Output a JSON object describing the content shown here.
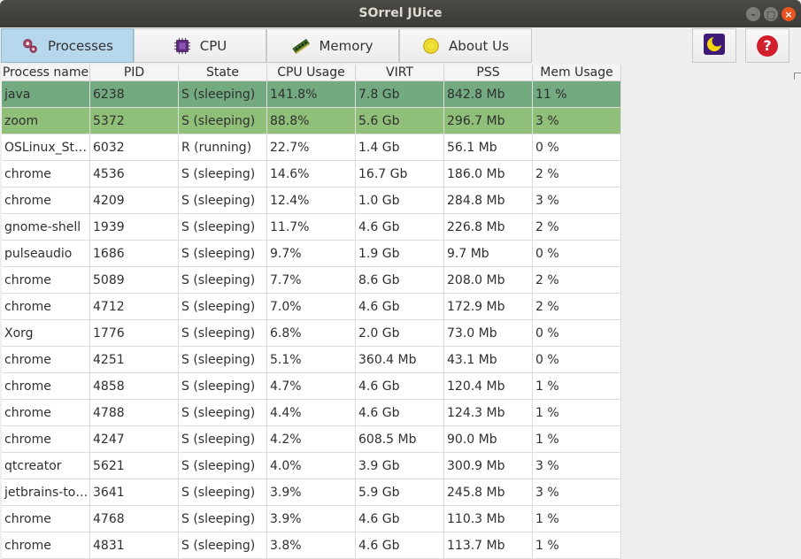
{
  "window": {
    "title": "SOrrel JUice"
  },
  "toolbar": {
    "tabs": [
      {
        "label": "Processes",
        "icon": "gears-icon",
        "active": true
      },
      {
        "label": "CPU",
        "icon": "cpu-chip-icon",
        "active": false
      },
      {
        "label": "Memory",
        "icon": "memory-module-icon",
        "active": false
      },
      {
        "label": "About Us",
        "icon": "smiley-coin-icon",
        "active": false
      }
    ],
    "theme_icon": "moon-icon",
    "help_label": "?"
  },
  "table": {
    "columns": [
      "Process name",
      "PID",
      "State",
      "CPU Usage",
      "VIRT",
      "PSS",
      "Mem Usage"
    ],
    "rows": [
      {
        "cells": [
          "java",
          "6238",
          "S (sleeping)",
          "141.8%",
          "7.8 Gb",
          "842.8 Mb",
          "11 %"
        ],
        "bg": "#73aa80"
      },
      {
        "cells": [
          "zoom",
          "5372",
          "S (sleeping)",
          "88.8%",
          "5.6 Gb",
          "296.7 Mb",
          "3 %"
        ],
        "bg": "#8fbf78"
      },
      {
        "cells": [
          "OSLinux_Studio",
          "6032",
          "R (running)",
          "22.7%",
          "1.4 Gb",
          "56.1 Mb",
          "0 %"
        ],
        "bg": "#ffffff"
      },
      {
        "cells": [
          "chrome",
          "4536",
          "S (sleeping)",
          "14.6%",
          "16.7 Gb",
          "186.0 Mb",
          "2 %"
        ],
        "bg": "#ffffff"
      },
      {
        "cells": [
          "chrome",
          "4209",
          "S (sleeping)",
          "12.4%",
          "1.0 Gb",
          "284.8 Mb",
          "3 %"
        ],
        "bg": "#ffffff"
      },
      {
        "cells": [
          "gnome-shell",
          "1939",
          "S (sleeping)",
          "11.7%",
          "4.6 Gb",
          "226.8 Mb",
          "2 %"
        ],
        "bg": "#ffffff"
      },
      {
        "cells": [
          "pulseaudio",
          "1686",
          "S (sleeping)",
          "9.7%",
          "1.9 Gb",
          "9.7 Mb",
          "0 %"
        ],
        "bg": "#ffffff"
      },
      {
        "cells": [
          "chrome",
          "5089",
          "S (sleeping)",
          "7.7%",
          "8.6 Gb",
          "208.0 Mb",
          "2 %"
        ],
        "bg": "#ffffff"
      },
      {
        "cells": [
          "chrome",
          "4712",
          "S (sleeping)",
          "7.0%",
          "4.6 Gb",
          "172.9 Mb",
          "2 %"
        ],
        "bg": "#ffffff"
      },
      {
        "cells": [
          "Xorg",
          "1776",
          "S (sleeping)",
          "6.8%",
          "2.0 Gb",
          "73.0 Mb",
          "0 %"
        ],
        "bg": "#ffffff"
      },
      {
        "cells": [
          "chrome",
          "4251",
          "S (sleeping)",
          "5.1%",
          "360.4 Mb",
          "43.1 Mb",
          "0 %"
        ],
        "bg": "#ffffff"
      },
      {
        "cells": [
          "chrome",
          "4858",
          "S (sleeping)",
          "4.7%",
          "4.6 Gb",
          "120.4 Mb",
          "1 %"
        ],
        "bg": "#ffffff"
      },
      {
        "cells": [
          "chrome",
          "4788",
          "S (sleeping)",
          "4.4%",
          "4.6 Gb",
          "124.3 Mb",
          "1 %"
        ],
        "bg": "#ffffff"
      },
      {
        "cells": [
          "chrome",
          "4247",
          "S (sleeping)",
          "4.2%",
          "608.5 Mb",
          "90.0 Mb",
          "1 %"
        ],
        "bg": "#ffffff"
      },
      {
        "cells": [
          "qtcreator",
          "5621",
          "S (sleeping)",
          "4.0%",
          "3.9 Gb",
          "300.9 Mb",
          "3 %"
        ],
        "bg": "#ffffff"
      },
      {
        "cells": [
          "jetbrains-toolbox",
          "3641",
          "S (sleeping)",
          "3.9%",
          "5.9 Gb",
          "245.8 Mb",
          "3 %"
        ],
        "bg": "#ffffff"
      },
      {
        "cells": [
          "chrome",
          "4768",
          "S (sleeping)",
          "3.9%",
          "4.6 Gb",
          "110.3 Mb",
          "1 %"
        ],
        "bg": "#ffffff"
      },
      {
        "cells": [
          "chrome",
          "4831",
          "S (sleeping)",
          "3.8%",
          "4.6 Gb",
          "113.7 Mb",
          "1 %"
        ],
        "bg": "#ffffff"
      }
    ]
  }
}
